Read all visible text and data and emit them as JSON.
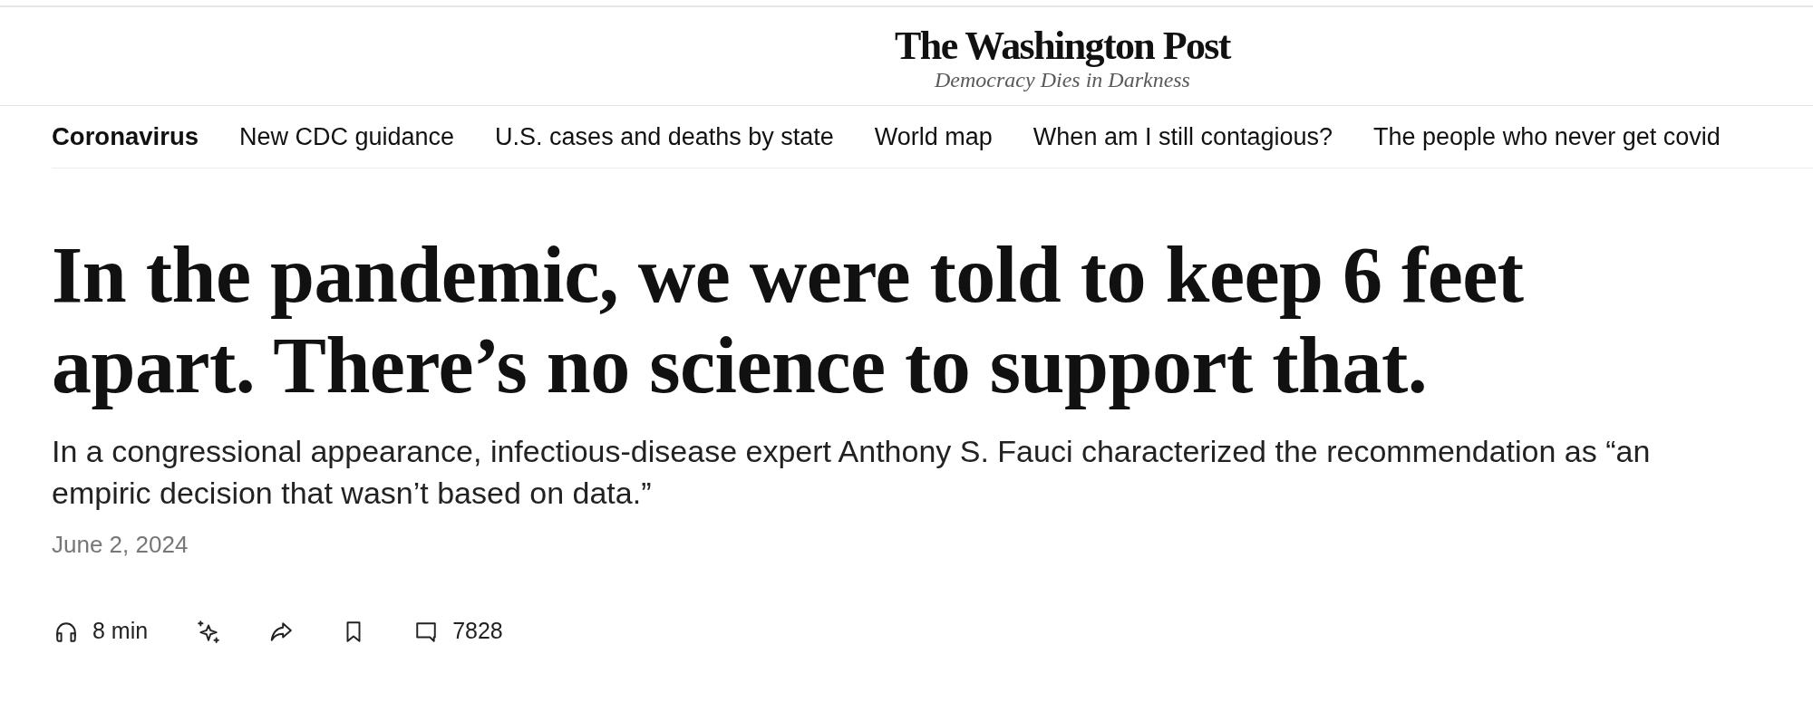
{
  "masthead": {
    "logo": "The Washington Post",
    "tagline": "Democracy Dies in Darkness"
  },
  "topic_nav": {
    "section": "Coronavirus",
    "links": [
      "New CDC guidance",
      "U.S. cases and deaths by state",
      "World map",
      "When am I still contagious?",
      "The people who never get covid"
    ]
  },
  "article": {
    "headline": "In the pandemic, we were told to keep 6 feet apart. There’s no science to support that.",
    "dek": "In a congressional appearance, infectious-disease expert Anthony S. Fauci characterized the recommendation as “an empiric decision that wasn’t based on data.”",
    "date": "June 2, 2024"
  },
  "actions": [
    {
      "kind": "listen",
      "label": "8 min"
    },
    {
      "kind": "summary"
    },
    {
      "kind": "share"
    },
    {
      "kind": "save"
    },
    {
      "kind": "comments",
      "label": "7828"
    }
  ]
}
